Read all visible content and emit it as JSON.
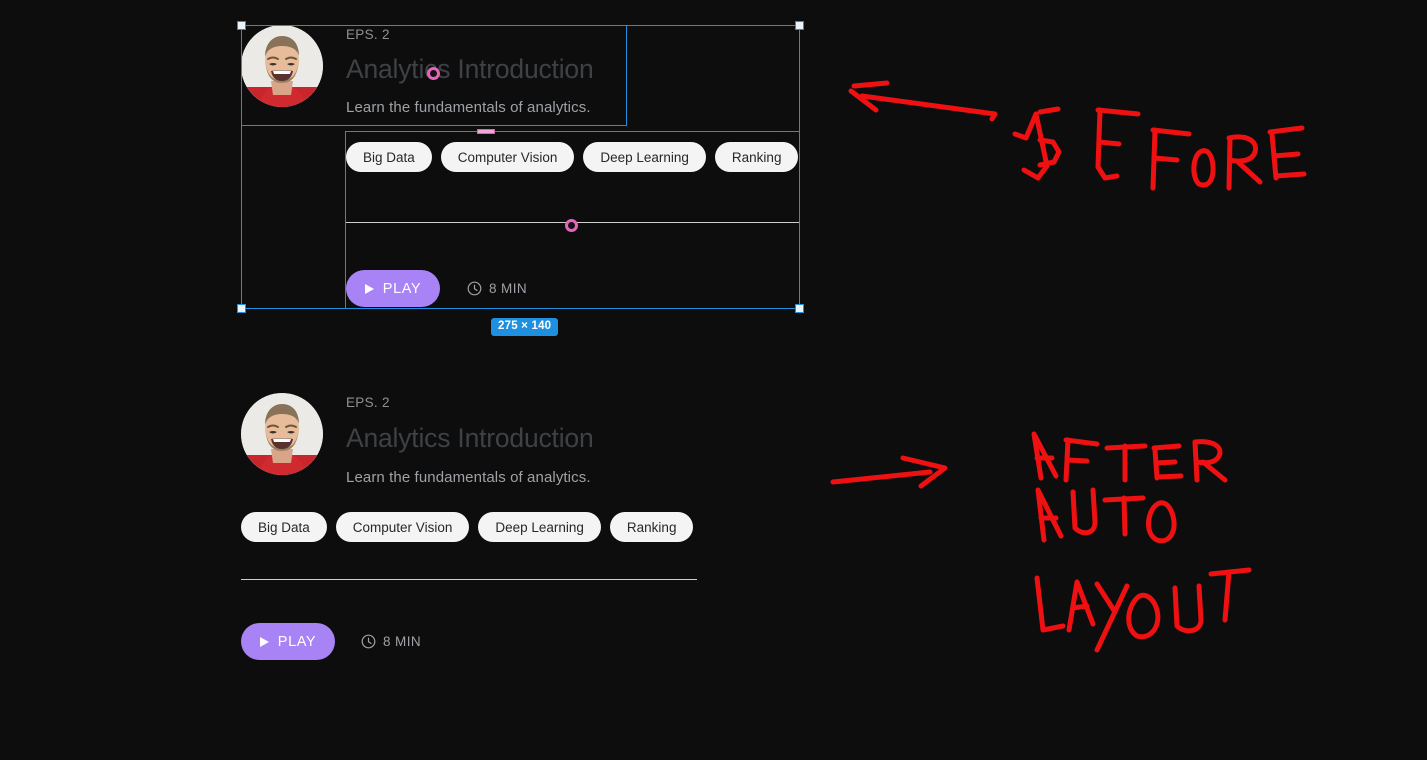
{
  "canvas": {
    "background_color": "#0d0d0d",
    "selection_color": "#1f8fe0",
    "accent_pink": "#e466b6",
    "play_button_color": "#a783f5",
    "tag_background": "#f4f4f4"
  },
  "before_card": {
    "episode_label": "EPS. 2",
    "title": "Analytics Introduction",
    "subtitle": "Learn the fundamentals of analytics.",
    "tags": [
      "Big Data",
      "Computer Vision",
      "Deep Learning",
      "Ranking"
    ],
    "play_label": "PLAY",
    "duration": "8 MIN",
    "avatar_name": "avatar-photo-man-laughing"
  },
  "after_card": {
    "episode_label": "EPS. 2",
    "title": "Analytics Introduction",
    "subtitle": "Learn the fundamentals of analytics.",
    "tags": [
      "Big Data",
      "Computer Vision",
      "Deep Learning",
      "Ranking"
    ],
    "play_label": "PLAY",
    "duration": "8 MIN",
    "avatar_name": "avatar-photo-man-laughing"
  },
  "selection": {
    "size_badge": "275 × 140"
  },
  "annotations": {
    "before_text": "BEFORE",
    "after_text": "AFTER AUTO LAYOUT",
    "ink_color": "#ef1111"
  }
}
